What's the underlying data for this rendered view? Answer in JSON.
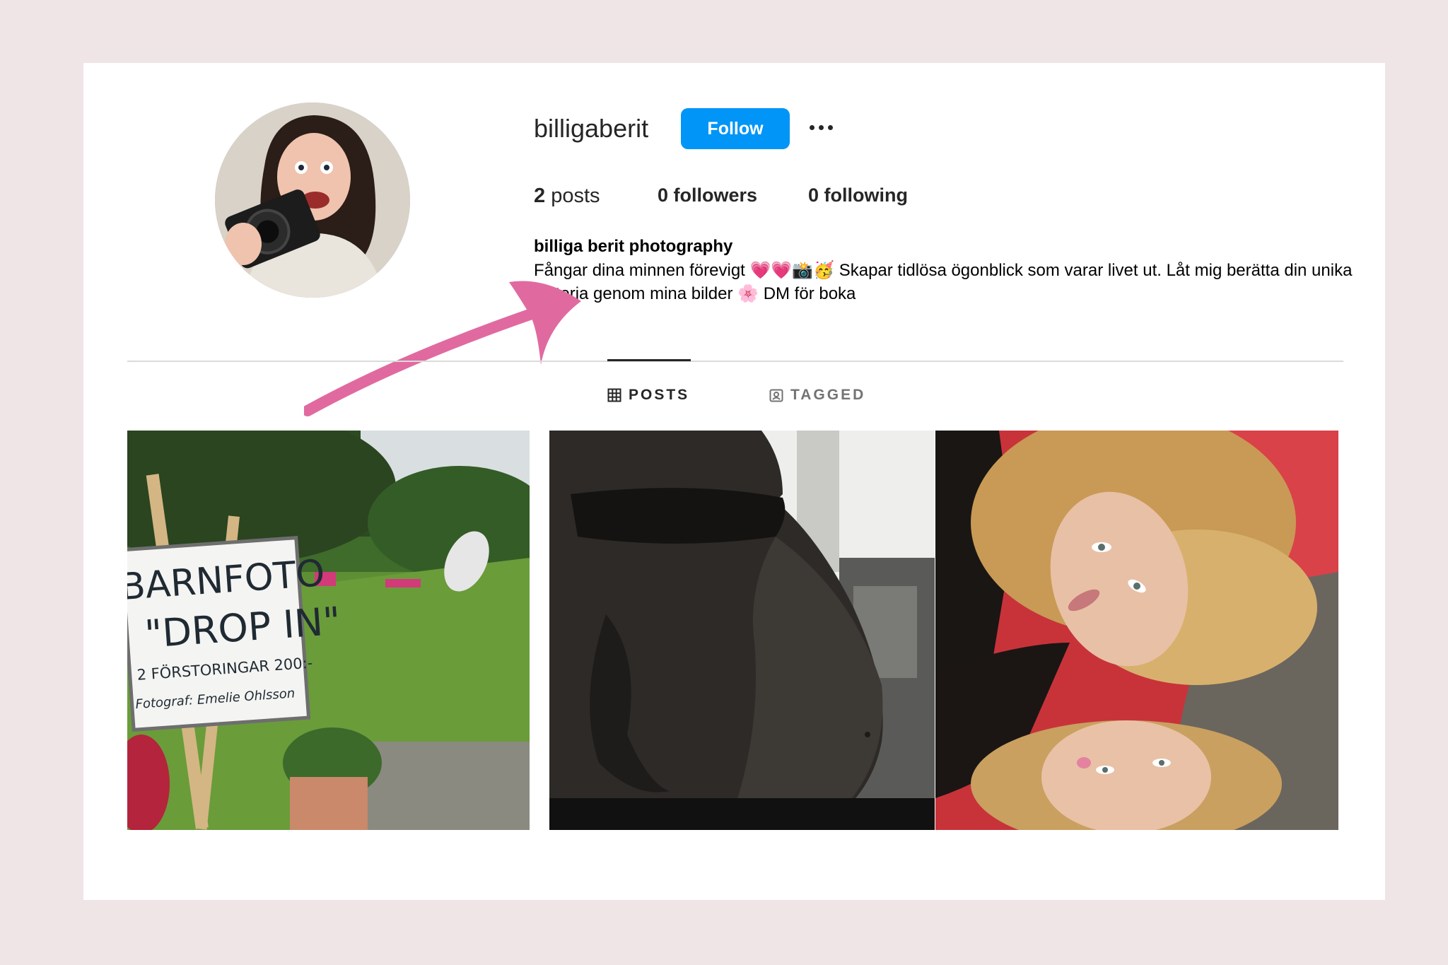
{
  "profile": {
    "username": "billigaberit",
    "follow_label": "Follow",
    "more_label": "More options"
  },
  "stats": {
    "posts_count": "2",
    "posts_label": "posts",
    "followers_count": "0",
    "followers_label": "followers",
    "following_count": "0",
    "following_label": "following"
  },
  "bio": {
    "name": "billiga berit photography",
    "text": "Fångar dina minnen förevigt 💗💗📸🥳 Skapar tidlösa ögonblick som varar livet ut. Låt mig berätta din unika historia genom mina bilder 🌸 DM för boka"
  },
  "tabs": [
    {
      "label": "POSTS",
      "active": true
    },
    {
      "label": "TAGGED",
      "active": false
    }
  ],
  "posts": [
    {
      "sign_lines": [
        "BARNFOTO",
        "\"DROP IN\"",
        "2 FÖRSTORINGAR 200:-",
        "Fotograf: Emelie Ohlsson"
      ]
    },
    {},
    {}
  ],
  "colors": {
    "background": "#efe5e7",
    "card": "#ffffff",
    "follow_button": "#0095f6",
    "arrow": "#e06aa0"
  }
}
